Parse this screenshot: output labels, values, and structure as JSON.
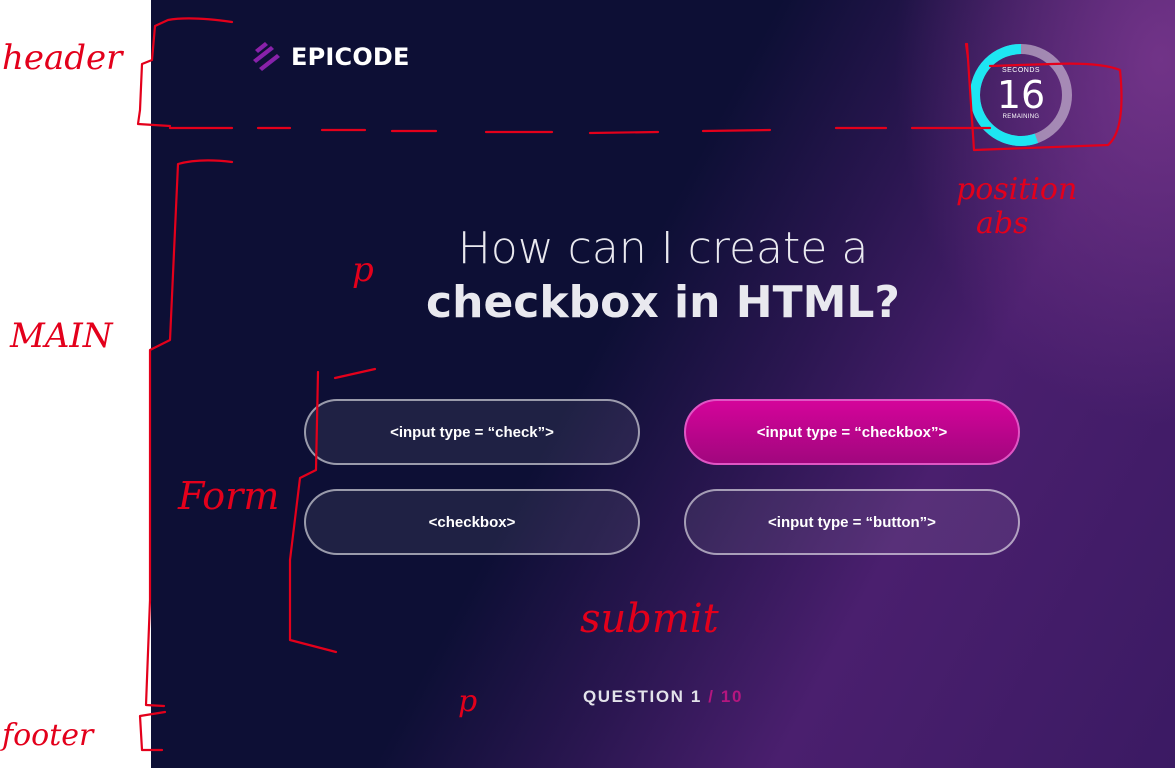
{
  "annotations": {
    "header": "header",
    "main": "MAIN",
    "form": "Form",
    "footer": "footer",
    "position": "position",
    "abs": "abs",
    "p1": "p",
    "p2": "p",
    "submit": "submit"
  },
  "brand": {
    "name": "EPICODE"
  },
  "timer": {
    "label_top": "SECONDS",
    "value": "16",
    "label_bottom": "REMAINING"
  },
  "question": {
    "line1": "How can I create a",
    "line2": "checkbox in HTML?"
  },
  "answers": [
    {
      "label": "<input type = “check”>",
      "selected": false
    },
    {
      "label": "<input type = “checkbox”>",
      "selected": true
    },
    {
      "label": "<checkbox>",
      "selected": false
    },
    {
      "label": "<input type = “button”>",
      "selected": false
    }
  ],
  "counter": {
    "prefix": "QUESTION 1",
    "separator": " / ",
    "total": "10"
  },
  "colors": {
    "accent": "#c2058f",
    "timer_ring": "#1ee6f2",
    "background": "#0d0f35"
  }
}
